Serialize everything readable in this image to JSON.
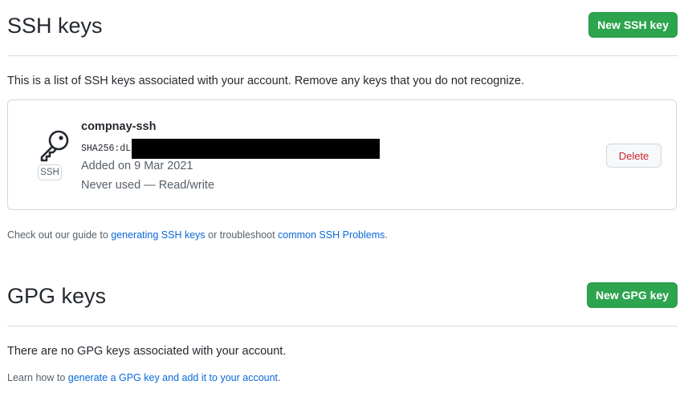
{
  "ssh": {
    "title": "SSH keys",
    "new_button": "New SSH key",
    "intro": "This is a list of SSH keys associated with your account. Remove any keys that you do not recognize.",
    "keys": [
      {
        "title": "compnay-ssh",
        "fingerprint_prefix": "SHA256:dL",
        "type_label": "SSH",
        "added": "Added on 9 Mar 2021",
        "usage": "Never used — Read/write",
        "delete_label": "Delete",
        "icon": "key-icon"
      }
    ],
    "guide": {
      "prefix": "Check out our guide to ",
      "link1": "generating SSH keys",
      "middle": " or troubleshoot ",
      "link2": "common SSH Problems",
      "suffix": "."
    }
  },
  "gpg": {
    "title": "GPG keys",
    "new_button": "New GPG key",
    "empty": "There are no GPG keys associated with your account.",
    "learn": {
      "prefix": "Learn how to ",
      "link": "generate a GPG key and add it to your account",
      "suffix": "."
    }
  },
  "colors": {
    "primary_button": "#2da44e",
    "danger": "#cf222e",
    "link": "#0969da",
    "border": "#d0d7de"
  }
}
